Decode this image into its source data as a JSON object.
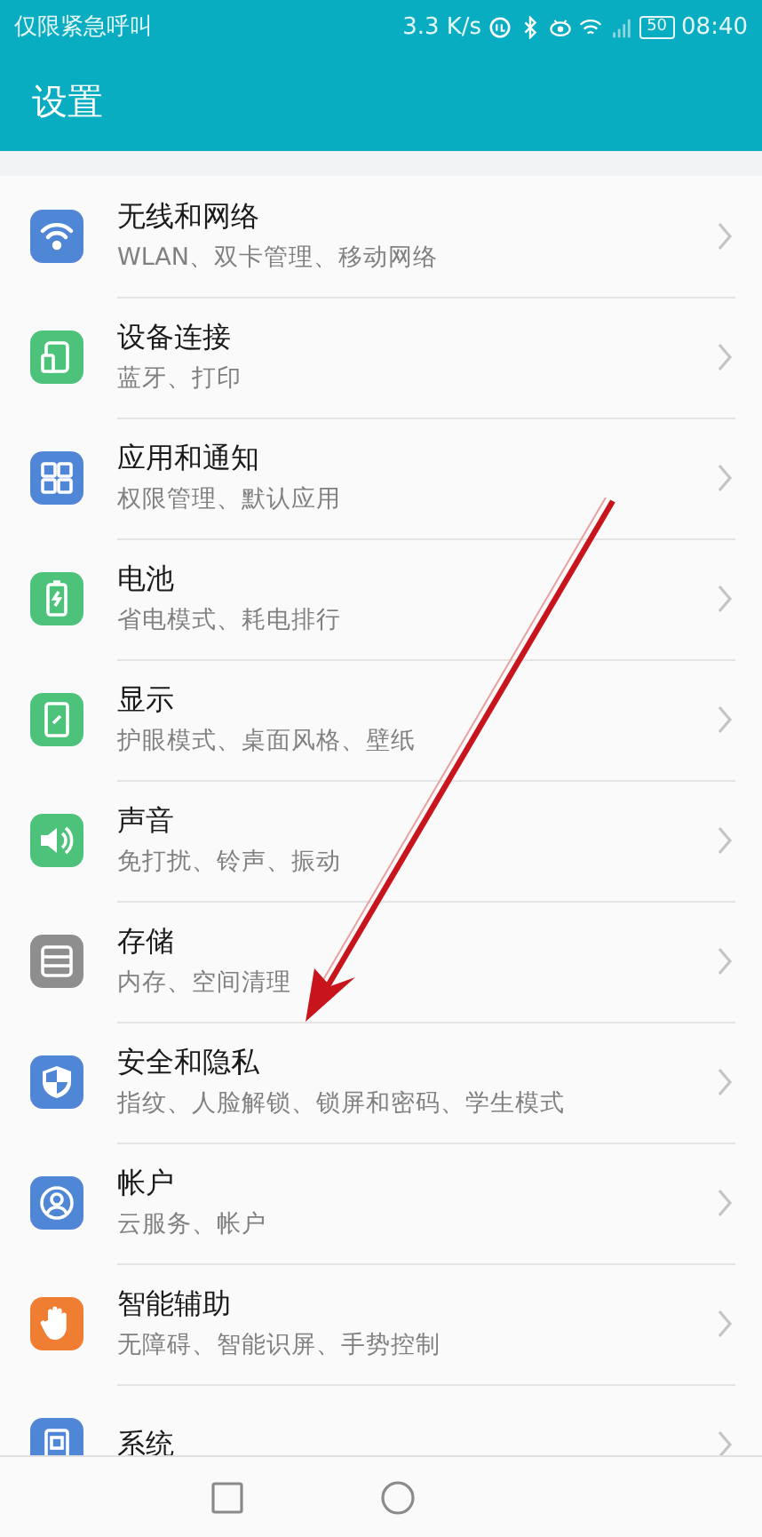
{
  "status_bar": {
    "carrier": "仅限紧急呼叫",
    "speed": "3.3 K/s",
    "battery": "50",
    "time": "08:40"
  },
  "title": "设置",
  "items": [
    {
      "color": "#4f86d6",
      "title": "无线和网络",
      "subtitle": "WLAN、双卡管理、移动网络"
    },
    {
      "color": "#4cc27a",
      "title": "设备连接",
      "subtitle": "蓝牙、打印"
    },
    {
      "color": "#4f86d6",
      "title": "应用和通知",
      "subtitle": "权限管理、默认应用"
    },
    {
      "color": "#4cc27a",
      "title": "电池",
      "subtitle": "省电模式、耗电排行"
    },
    {
      "color": "#4cc27a",
      "title": "显示",
      "subtitle": "护眼模式、桌面风格、壁纸"
    },
    {
      "color": "#4cc27a",
      "title": "声音",
      "subtitle": "免打扰、铃声、振动"
    },
    {
      "color": "#8e8e8e",
      "title": "存储",
      "subtitle": "内存、空间清理"
    },
    {
      "color": "#4f86d6",
      "title": "安全和隐私",
      "subtitle": "指纹、人脸解锁、锁屏和密码、学生模式"
    },
    {
      "color": "#4f86d6",
      "title": "帐户",
      "subtitle": "云服务、帐户"
    },
    {
      "color": "#ef7d32",
      "title": "智能辅助",
      "subtitle": "无障碍、智能识屏、手势控制"
    },
    {
      "color": "#4f86d6",
      "title": "系统"
    }
  ]
}
